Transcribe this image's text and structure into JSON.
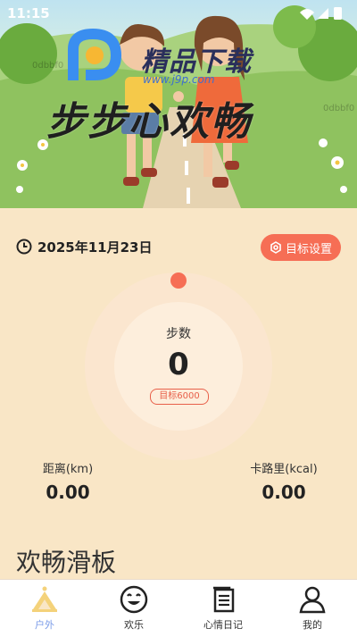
{
  "status_bar": {
    "time": "11:15"
  },
  "watermark": {
    "title": "精品下载",
    "url": "www.j9p.com",
    "small_left": "0dbbf0",
    "small_right": "0dbbf0"
  },
  "hero": {
    "title": "步步心欢畅"
  },
  "date": {
    "text": "2025年11月23日"
  },
  "target_button": {
    "label": "目标设置"
  },
  "steps": {
    "label": "步数",
    "value": "0",
    "goal": "目标6000"
  },
  "stats": {
    "distance": {
      "label": "距离(km)",
      "value": "0.00"
    },
    "calories": {
      "label": "卡路里(kcal)",
      "value": "0.00"
    }
  },
  "section": {
    "title": "欢畅滑板"
  },
  "tabs": [
    {
      "label": "户外",
      "icon": "outdoor-icon",
      "active": true
    },
    {
      "label": "欢乐",
      "icon": "smile-icon",
      "active": false
    },
    {
      "label": "心情日记",
      "icon": "diary-icon",
      "active": false
    },
    {
      "label": "我的",
      "icon": "profile-icon",
      "active": false
    }
  ],
  "colors": {
    "accent": "#f66e55",
    "background": "#f9e6c6",
    "tab_active": "#7a9be8"
  }
}
